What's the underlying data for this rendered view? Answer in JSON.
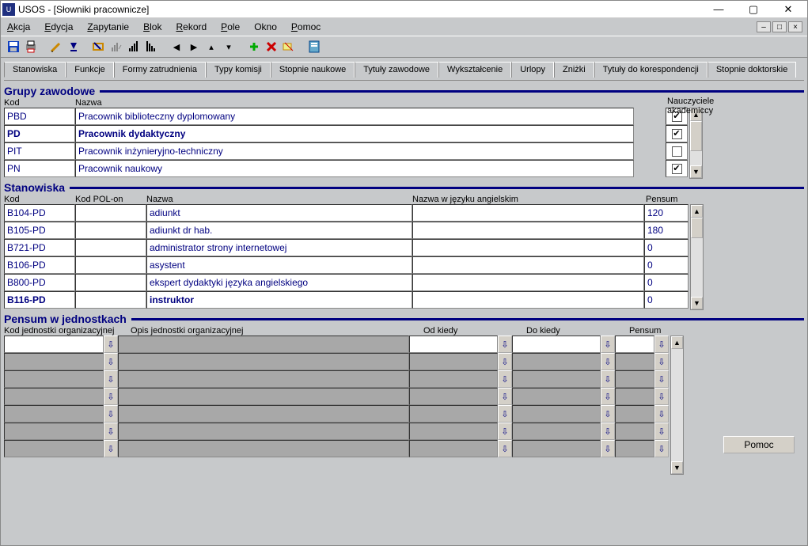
{
  "title": "USOS - [Słowniki pracownicze]",
  "menu": [
    "Akcja",
    "Edycja",
    "Zapytanie",
    "Blok",
    "Rekord",
    "Pole",
    "Okno",
    "Pomoc"
  ],
  "tabs": [
    "Stanowiska",
    "Funkcje",
    "Formy zatrudnienia",
    "Typy komisji",
    "Stopnie naukowe",
    "Tytuły zawodowe",
    "Wykształcenie",
    "Urlopy",
    "Zniżki",
    "Tytuły do korespondencji",
    "Stopnie doktorskie"
  ],
  "section1": {
    "title": "Grupy zawodowe",
    "header_kod": "Kod",
    "header_nazwa": "Nazwa",
    "header_nauczyciele1": "Nauczyciele",
    "header_nauczyciele2": "akademiccy",
    "rows": [
      {
        "kod": "PBD",
        "nazwa": "Pracownik biblioteczny dyplomowany",
        "chk": true,
        "bold": false
      },
      {
        "kod": "PD",
        "nazwa": "Pracownik dydaktyczny",
        "chk": true,
        "bold": true
      },
      {
        "kod": "PIT",
        "nazwa": "Pracownik inżynieryjno-techniczny",
        "chk": false,
        "bold": false
      },
      {
        "kod": "PN",
        "nazwa": "Pracownik naukowy",
        "chk": true,
        "bold": false
      }
    ]
  },
  "section2": {
    "title": "Stanowiska",
    "header_kod": "Kod",
    "header_kodpolon": "Kod POL-on",
    "header_nazwa": "Nazwa",
    "header_nazwa_en": "Nazwa w języku angielskim",
    "header_pensum": "Pensum",
    "rows": [
      {
        "kod": "B104-PD",
        "polon": "",
        "nazwa": "adiunkt",
        "en": "",
        "pensum": "120",
        "bold": false
      },
      {
        "kod": "B105-PD",
        "polon": "",
        "nazwa": "adiunkt dr hab.",
        "en": "",
        "pensum": "180",
        "bold": false
      },
      {
        "kod": "B721-PD",
        "polon": "",
        "nazwa": "administrator strony internetowej",
        "en": "",
        "pensum": "0",
        "bold": false
      },
      {
        "kod": "B106-PD",
        "polon": "",
        "nazwa": "asystent",
        "en": "",
        "pensum": "0",
        "bold": false
      },
      {
        "kod": "B800-PD",
        "polon": "",
        "nazwa": "ekspert dydaktyki języka angielskiego",
        "en": "",
        "pensum": "0",
        "bold": false
      },
      {
        "kod": "B116-PD",
        "polon": "",
        "nazwa": "instruktor",
        "en": "",
        "pensum": "0",
        "bold": true,
        "pensum_highlight": true
      }
    ]
  },
  "section3": {
    "title": "Pensum w jednostkach",
    "header_kod": "Kod jednostki organizacyjnej",
    "header_opis": "Opis jednostki organizacyjnej",
    "header_od": "Od kiedy",
    "header_do": "Do kiedy",
    "header_pensum": "Pensum",
    "row_count": 7
  },
  "help_button": "Pomoc"
}
